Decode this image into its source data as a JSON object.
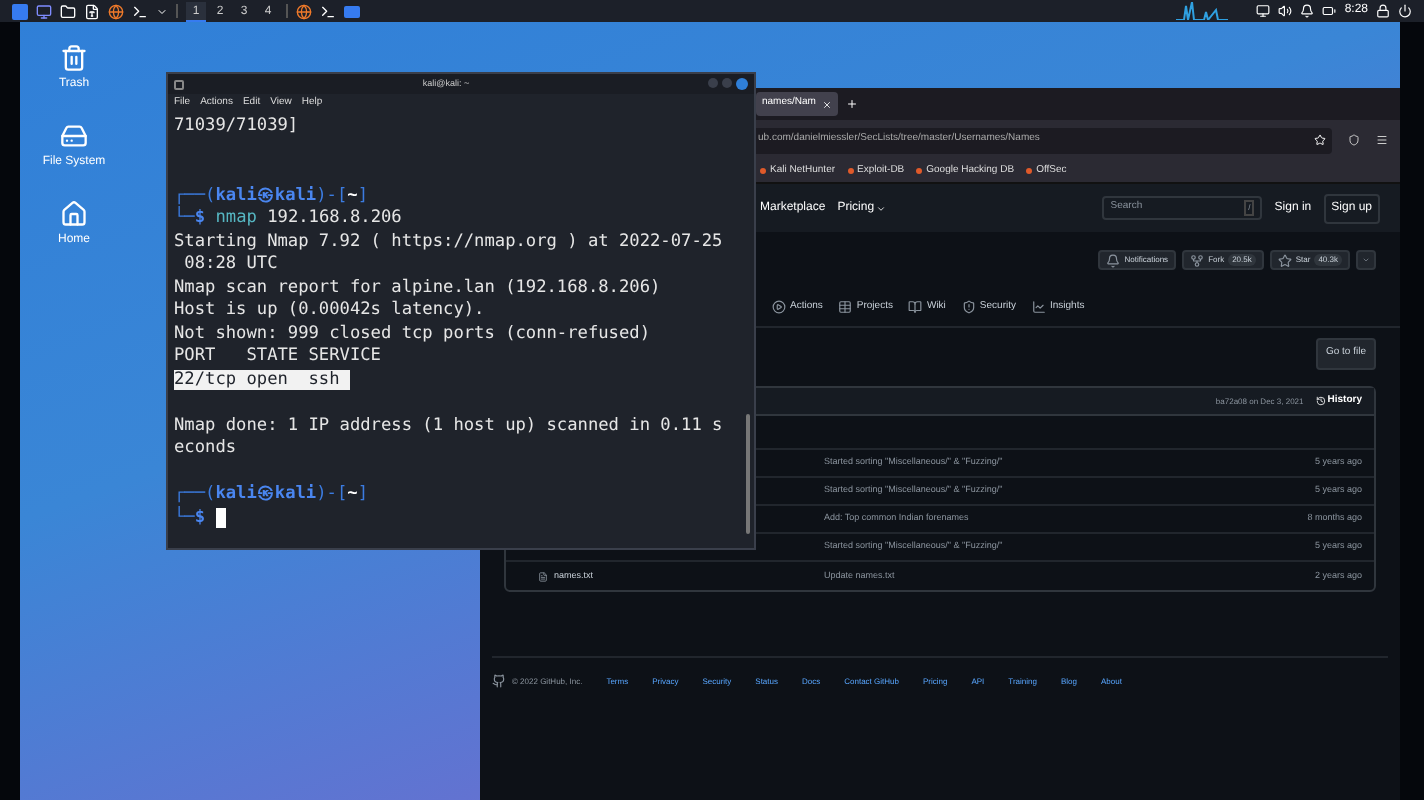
{
  "taskbar": {
    "workspaces": [
      {
        "label": "1",
        "selected": true
      },
      {
        "label": "2",
        "selected": false
      },
      {
        "label": "3",
        "selected": false
      },
      {
        "label": "4",
        "selected": false
      }
    ],
    "clock": "8:28"
  },
  "desktop_icons": [
    {
      "kind": "trash",
      "label": "Trash"
    },
    {
      "kind": "drive",
      "label": "File System"
    },
    {
      "kind": "home",
      "label": "Home"
    }
  ],
  "terminal": {
    "title": "kali@kali: ~",
    "menu": [
      "File",
      "Actions",
      "Edit",
      "View",
      "Help"
    ],
    "lines": [
      {
        "kind": "output",
        "text": "71039/71039]"
      },
      {
        "kind": "blank"
      },
      {
        "kind": "blank"
      },
      {
        "kind": "prompt",
        "segments": [
          {
            "kind": "frame",
            "text": "┌──("
          },
          {
            "kind": "user",
            "text": "kali㉿kali"
          },
          {
            "kind": "frame",
            "text": ")-["
          },
          {
            "kind": "path",
            "text": "~"
          },
          {
            "kind": "frame",
            "text": "]"
          }
        ]
      },
      {
        "kind": "prompt",
        "segments": [
          {
            "kind": "frame",
            "text": "└─"
          },
          {
            "kind": "user",
            "text": "$ "
          },
          {
            "kind": "command",
            "text": "nmap"
          },
          {
            "kind": "arg",
            "text": " 192.168.8.206"
          }
        ]
      },
      {
        "kind": "output",
        "text": "Starting Nmap 7.92 ( https://nmap.org ) at 2022-07-25"
      },
      {
        "kind": "output",
        "text": " 08:28 UTC"
      },
      {
        "kind": "output",
        "text": "Nmap scan report for alpine.lan (192.168.8.206)"
      },
      {
        "kind": "output",
        "text": "Host is up (0.00042s latency)."
      },
      {
        "kind": "output",
        "text": "Not shown: 999 closed tcp ports (conn-refused)"
      },
      {
        "kind": "output",
        "text": "PORT   STATE SERVICE"
      },
      {
        "kind": "selection",
        "text": "22/tcp open  ssh "
      },
      {
        "kind": "blank"
      },
      {
        "kind": "output",
        "text": "Nmap done: 1 IP address (1 host up) scanned in 0.11 s"
      },
      {
        "kind": "output",
        "text": "econds"
      },
      {
        "kind": "blank"
      },
      {
        "kind": "prompt",
        "segments": [
          {
            "kind": "frame",
            "text": "┌──("
          },
          {
            "kind": "user",
            "text": "kali㉿kali"
          },
          {
            "kind": "frame",
            "text": ")-["
          },
          {
            "kind": "path",
            "text": "~"
          },
          {
            "kind": "frame",
            "text": "]"
          }
        ]
      },
      {
        "kind": "prompt",
        "cursor": true,
        "segments": [
          {
            "kind": "frame",
            "text": "└─"
          },
          {
            "kind": "user",
            "text": "$ "
          }
        ]
      }
    ]
  },
  "browser": {
    "tab_title": "names/Nam",
    "url": "ub.com/danielmiessler/SecLists/tree/master/Usernames/Names",
    "bookmarks": [
      "Kali NetHunter",
      "Exploit-DB",
      "Google Hacking DB",
      "OffSec"
    ],
    "nav_links": [
      "Marketplace",
      "Pricing"
    ],
    "search": {
      "placeholder": "Search",
      "key": "/"
    },
    "sign_in": "Sign in",
    "sign_up": "Sign up",
    "repo_buttons": [
      {
        "kind": "bell",
        "label": "Notifications"
      },
      {
        "kind": "fork",
        "label": "Fork",
        "count": "20.5k"
      },
      {
        "kind": "star",
        "label": "Star",
        "count": "40.3k"
      }
    ],
    "repo_tabs": [
      {
        "kind": "play",
        "label": "Actions"
      },
      {
        "kind": "table",
        "label": "Projects"
      },
      {
        "kind": "book",
        "label": "Wiki"
      },
      {
        "kind": "shield",
        "label": "Security"
      },
      {
        "kind": "graph",
        "label": "Insights"
      }
    ],
    "go_to_file": "Go to file",
    "commit": {
      "hash": "ba72a08",
      "date": "on Dec 3, 2021",
      "history": "History"
    },
    "files": [
      {
        "message": "Started sorting \"Miscellaneous/\" & \"Fuzzing/\"",
        "age": "5 years ago"
      },
      {
        "message": "Started sorting \"Miscellaneous/\" & \"Fuzzing/\"",
        "age": "5 years ago"
      },
      {
        "message": "Add: Top common Indian forenames",
        "age": "8 months ago"
      },
      {
        "message": "Started sorting \"Miscellaneous/\" & \"Fuzzing/\"",
        "age": "5 years ago"
      },
      {
        "name": "names.txt",
        "message": "Update names.txt",
        "age": "2 years ago"
      }
    ],
    "footer": {
      "copyright": "© 2022 GitHub, Inc.",
      "links": [
        "Terms",
        "Privacy",
        "Security",
        "Status",
        "Docs",
        "Contact GitHub",
        "Pricing",
        "API",
        "Training",
        "Blog",
        "About"
      ]
    }
  }
}
